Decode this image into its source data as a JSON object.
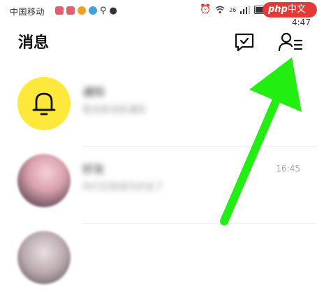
{
  "status_bar": {
    "carrier": "中国移动",
    "app_icon_colors": [
      "#e06070",
      "#e06070",
      "#f0a020",
      "#40a0e0"
    ],
    "icons": [
      "alarm-icon",
      "wifi-icon",
      "signal-icon",
      "battery-icon"
    ],
    "network_label": "26",
    "time": "下4:47"
  },
  "header": {
    "title": "消息",
    "compose_icon": "message-check-icon",
    "contacts_icon": "contacts-list-icon"
  },
  "conversations": [
    {
      "name": "通知",
      "preview": "暂无新消息通知",
      "time": "",
      "avatar": "bell-icon"
    },
    {
      "name": "好友",
      "preview": "你们已经成为好友了",
      "time": "16:45",
      "avatar": "user-photo"
    },
    {
      "name": "",
      "preview": "",
      "time": "",
      "avatar": "user-photo"
    }
  ],
  "watermark": {
    "text_latin": "php",
    "text_cn": "中文网"
  },
  "colors": {
    "accent_yellow": "#ffe83c",
    "arrow_green": "#22ee11"
  }
}
